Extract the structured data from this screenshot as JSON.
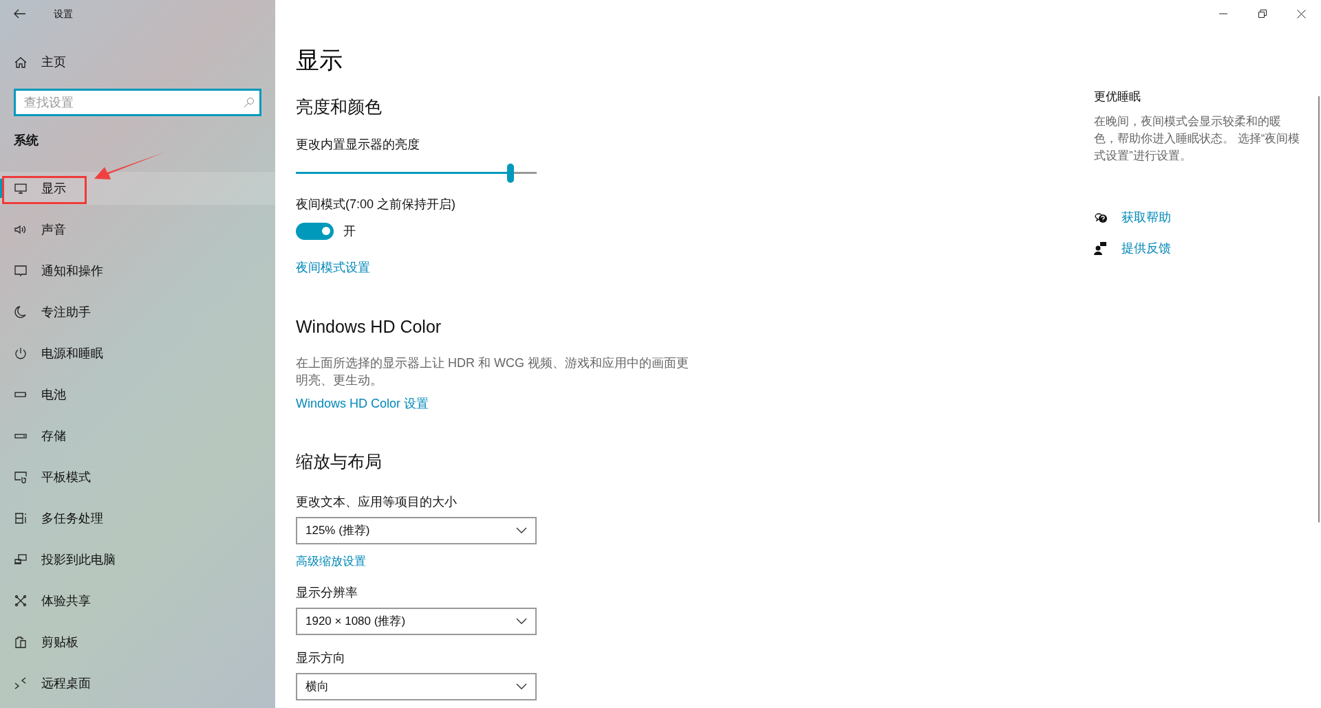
{
  "window": {
    "title": "设置"
  },
  "sidebar": {
    "home": "主页",
    "search": {
      "placeholder": "查找设置"
    },
    "section": "系统",
    "items": [
      {
        "label": "显示",
        "selected": true
      },
      {
        "label": "声音",
        "selected": false
      },
      {
        "label": "通知和操作",
        "selected": false
      },
      {
        "label": "专注助手",
        "selected": false
      },
      {
        "label": "电源和睡眠",
        "selected": false
      },
      {
        "label": "电池",
        "selected": false
      },
      {
        "label": "存储",
        "selected": false
      },
      {
        "label": "平板模式",
        "selected": false
      },
      {
        "label": "多任务处理",
        "selected": false
      },
      {
        "label": "投影到此电脑",
        "selected": false
      },
      {
        "label": "体验共享",
        "selected": false
      },
      {
        "label": "剪贴板",
        "selected": false
      },
      {
        "label": "远程桌面",
        "selected": false
      }
    ]
  },
  "main": {
    "title": "显示",
    "brightness": {
      "heading": "亮度和颜色",
      "label": "更改内置显示器的亮度",
      "level": 0.89
    },
    "night_mode": {
      "label": "夜间模式(7:00 之前保持开启)",
      "on": true,
      "state": "开",
      "link": "夜间模式设置"
    },
    "hd_color": {
      "heading": "Windows HD Color",
      "description": "在上面所选择的显示器上让 HDR 和 WCG 视频、游戏和应用中的画面更明亮、更生动。",
      "link": "Windows HD Color 设置"
    },
    "scale": {
      "heading": "缩放与布局",
      "fields": [
        {
          "label": "更改文本、应用等项目的大小",
          "value": "125% (推荐)",
          "link": "高级缩放设置"
        },
        {
          "label": "显示分辨率",
          "value": "1920 × 1080 (推荐)"
        },
        {
          "label": "显示方向",
          "value": "横向"
        }
      ]
    }
  },
  "aside": {
    "heading": "更优睡眠",
    "text": "在晚间，夜间模式会显示较柔和的暖色，帮助你进入睡眠状态。 选择“夜间模式设置”进行设置。",
    "links": [
      {
        "label": "获取帮助"
      },
      {
        "label": "提供反馈"
      }
    ]
  }
}
